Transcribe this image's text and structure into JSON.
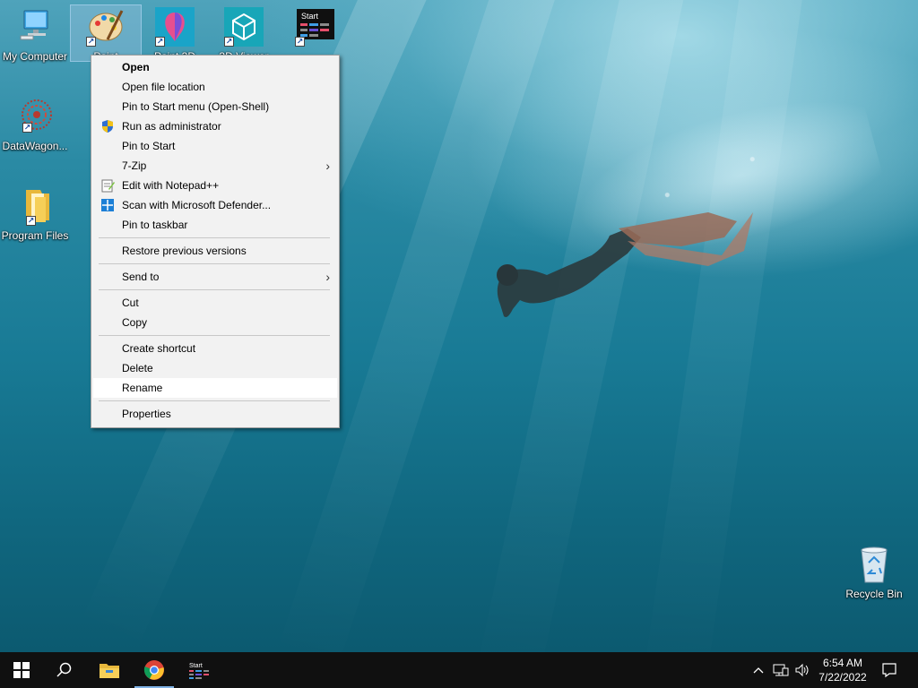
{
  "desktop": {
    "icons": [
      {
        "label": "My Computer"
      },
      {
        "label": "Paint"
      },
      {
        "label": "Paint 3D"
      },
      {
        "label": "3D Viewer"
      },
      {
        "label": "Start",
        "caption": "..."
      },
      {
        "label": "DataWagon..."
      },
      {
        "label": "Program Files"
      },
      {
        "label": "Recycle Bin"
      }
    ]
  },
  "context_menu": {
    "items": [
      {
        "label": "Open",
        "bold": true
      },
      {
        "label": "Open file location"
      },
      {
        "label": "Pin to Start menu (Open-Shell)"
      },
      {
        "label": "Run as administrator",
        "icon": "shield-icon"
      },
      {
        "label": "Pin to Start"
      },
      {
        "label": "7-Zip",
        "submenu": true
      },
      {
        "label": "Edit with Notepad++",
        "icon": "notepad-plus-plus-icon"
      },
      {
        "label": "Scan with Microsoft Defender...",
        "icon": "defender-icon"
      },
      {
        "label": "Pin to taskbar"
      },
      {
        "label": "Restore previous versions"
      },
      {
        "label": "Send to",
        "submenu": true
      },
      {
        "label": "Cut"
      },
      {
        "label": "Copy"
      },
      {
        "label": "Create shortcut"
      },
      {
        "label": "Delete"
      },
      {
        "label": "Rename",
        "highlighted": true
      },
      {
        "label": "Properties"
      }
    ],
    "arrow_glyph": "›"
  },
  "taskbar": {
    "pinned": [
      {
        "name": "start-button",
        "icon": "windows-logo-icon"
      },
      {
        "name": "search-button",
        "icon": "search-icon"
      },
      {
        "name": "file-explorer",
        "icon": "folder-icon"
      },
      {
        "name": "chrome",
        "icon": "chrome-icon"
      },
      {
        "name": "open-shell",
        "icon": "start-tile-icon",
        "label": "Start"
      }
    ],
    "tray": {
      "chevron": "^",
      "time": "6:54 AM",
      "date": "7/22/2022"
    }
  },
  "colors": {
    "menu_bg": "#f2f2f2",
    "menu_highlight": "#ffffff",
    "taskbar_bg": "#101010",
    "selection": "#aac8e6"
  }
}
